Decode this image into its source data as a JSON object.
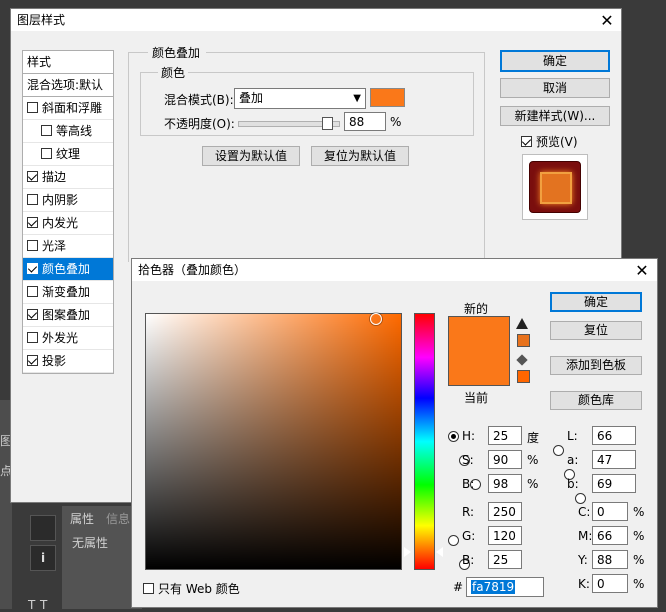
{
  "background_app": {
    "tabs": [
      "属性",
      "信息"
    ],
    "no_properties": "无属性",
    "side_fragments": [
      "图",
      "点",
      "T",
      "T"
    ]
  },
  "layer_style": {
    "title": "图层样式",
    "styles_header": "样式",
    "blend_options": "混合选项:默认",
    "items": [
      {
        "label": "斜面和浮雕",
        "checked": false,
        "indent": false,
        "selected": false
      },
      {
        "label": "等高线",
        "checked": false,
        "indent": true,
        "selected": false
      },
      {
        "label": "纹理",
        "checked": false,
        "indent": true,
        "selected": false
      },
      {
        "label": "描边",
        "checked": true,
        "indent": false,
        "selected": false
      },
      {
        "label": "内阴影",
        "checked": false,
        "indent": false,
        "selected": false
      },
      {
        "label": "内发光",
        "checked": true,
        "indent": false,
        "selected": false
      },
      {
        "label": "光泽",
        "checked": false,
        "indent": false,
        "selected": false
      },
      {
        "label": "颜色叠加",
        "checked": true,
        "indent": false,
        "selected": true
      },
      {
        "label": "渐变叠加",
        "checked": false,
        "indent": false,
        "selected": false
      },
      {
        "label": "图案叠加",
        "checked": true,
        "indent": false,
        "selected": false
      },
      {
        "label": "外发光",
        "checked": false,
        "indent": false,
        "selected": false
      },
      {
        "label": "投影",
        "checked": true,
        "indent": false,
        "selected": false
      }
    ],
    "section_title": "颜色叠加",
    "subsection_title": "颜色",
    "blend_mode_label": "混合模式(B):",
    "blend_mode_value": "叠加",
    "overlay_color": "#fa7819",
    "opacity_label": "不透明度(O):",
    "opacity_value": "88",
    "opacity_unit": "%",
    "opacity_fraction": 0.88,
    "make_default": "设置为默认值",
    "reset_default": "复位为默认值",
    "ok": "确定",
    "cancel": "取消",
    "new_style": "新建样式(W)...",
    "preview_label": "预览(V)",
    "preview_checked": true
  },
  "color_picker": {
    "title": "拾色器（叠加颜色）",
    "new_label": "新的",
    "current_label": "当前",
    "new_color": "#fa7819",
    "current_color": "#fa7819",
    "ok": "确定",
    "reset": "复位",
    "add_to_swatches": "添加到色板",
    "color_libraries": "颜色库",
    "web_only_label": "只有 Web 颜色",
    "web_only_checked": false,
    "hsb": [
      {
        "key": "H:",
        "value": "25",
        "unit": "度",
        "selected": true
      },
      {
        "key": "S:",
        "value": "90",
        "unit": "%",
        "selected": false
      },
      {
        "key": "B:",
        "value": "98",
        "unit": "%",
        "selected": false
      }
    ],
    "rgb": [
      {
        "key": "R:",
        "value": "250"
      },
      {
        "key": "G:",
        "value": "120"
      },
      {
        "key": "B:",
        "value": "25"
      }
    ],
    "lab": [
      {
        "key": "L:",
        "value": "66"
      },
      {
        "key": "a:",
        "value": "47"
      },
      {
        "key": "b:",
        "value": "69"
      }
    ],
    "cmyk": [
      {
        "key": "C:",
        "value": "0",
        "unit": "%"
      },
      {
        "key": "M:",
        "value": "66",
        "unit": "%"
      },
      {
        "key": "Y:",
        "value": "88",
        "unit": "%"
      },
      {
        "key": "K:",
        "value": "0",
        "unit": "%"
      }
    ],
    "hex_label": "#",
    "hex_value": "fa7819",
    "hue_color": "#ff6a00",
    "gamut_swatch": "#e8721c",
    "web_swatch": "#ff6600"
  }
}
